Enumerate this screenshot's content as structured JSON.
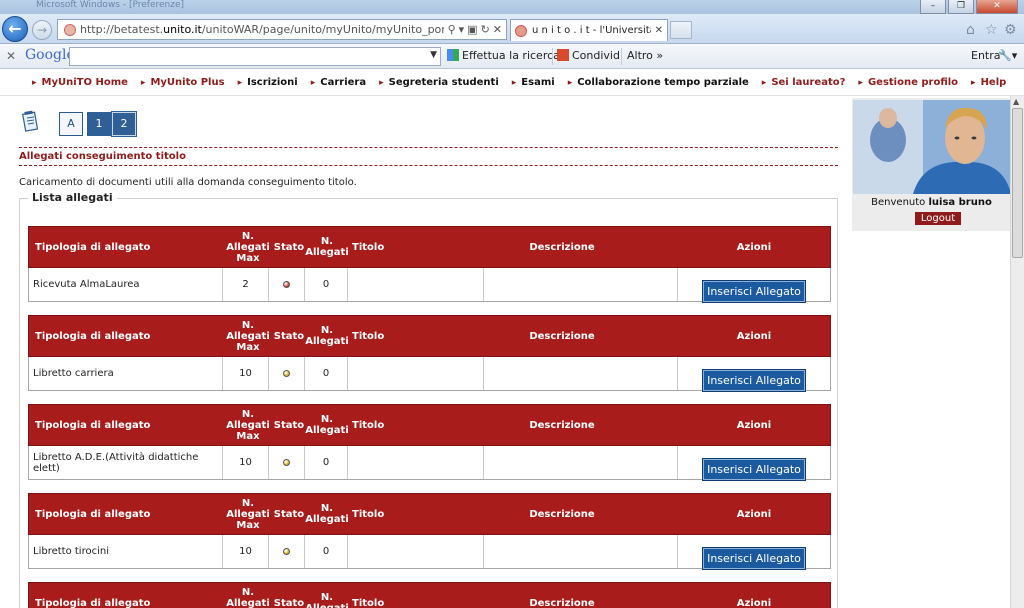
{
  "browser": {
    "titlebar_text": "Microsoft Windows - [Preferenze]",
    "address": "http://betatest.",
    "address_domain": "unito.it",
    "address_rest": "/unitoWAR/page/unito/myUnito/myUnito_portal_page_segrete",
    "tab_label": "u n i t o . i t - l'Università di ...",
    "google_search_value": "",
    "search_label": "Effettua la ricerca",
    "share_label": "Condividi",
    "more_label": "Altro",
    "login_label": "Entra",
    "google_logo": "Google"
  },
  "menu": {
    "items": [
      {
        "label": "MyUniTO Home",
        "red": true
      },
      {
        "label": "MyUnito Plus",
        "red": true
      },
      {
        "label": "Iscrizioni",
        "red": false
      },
      {
        "label": "Carriera",
        "red": false
      },
      {
        "label": "Segreteria studenti",
        "red": false
      },
      {
        "label": "Esami",
        "red": false
      },
      {
        "label": "Collaborazione tempo parziale",
        "red": false
      },
      {
        "label": "Sei laureato?",
        "red": true
      },
      {
        "label": "Gestione profilo",
        "red": true
      },
      {
        "label": "Help",
        "red": true
      }
    ]
  },
  "steps": {
    "a": "A",
    "one": "1",
    "two": "2"
  },
  "section": {
    "title": "Allegati conseguimento titolo",
    "description": "Caricamento di documenti utili alla domanda conseguimento titolo.",
    "legend": "Lista allegati"
  },
  "table": {
    "headers": {
      "tipologia": "Tipologia di allegato",
      "max": "N. Allegati Max",
      "stato": "Stato",
      "n": "N. Allegati",
      "titolo": "Titolo",
      "descrizione": "Descrizione",
      "azioni": "Azioni"
    },
    "rows": [
      {
        "tipologia": "Ricevuta AlmaLaurea",
        "max": "2",
        "status_color": "#d93b2b",
        "n": "0",
        "titolo": "",
        "descrizione": "",
        "action": "Inserisci Allegato"
      },
      {
        "tipologia": "Libretto carriera",
        "max": "10",
        "status_color": "#e0b51c",
        "n": "0",
        "titolo": "",
        "descrizione": "",
        "action": "Inserisci Allegato"
      },
      {
        "tipologia": "Libretto A.D.E.(Attività didattiche elett)",
        "max": "10",
        "status_color": "#e0b51c",
        "n": "0",
        "titolo": "",
        "descrizione": "",
        "action": "Inserisci Allegato"
      },
      {
        "tipologia": "Libretto tirocini",
        "max": "10",
        "status_color": "#e0b51c",
        "n": "0",
        "titolo": "",
        "descrizione": "",
        "action": "Inserisci Allegato"
      }
    ]
  },
  "sidebar": {
    "welcome": "Benvenuto",
    "username": "luisa bruno",
    "logout": "Logout"
  },
  "colors": {
    "brand_red": "#a81c1c",
    "button_blue": "#1b5a9e"
  }
}
